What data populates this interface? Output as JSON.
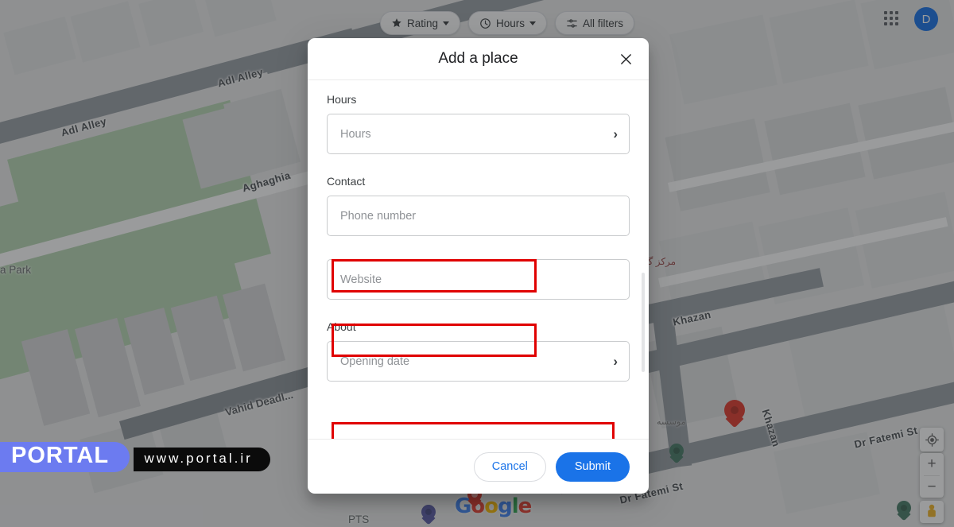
{
  "topbar": {
    "filters": [
      {
        "label": "Rating",
        "icon": "star-icon",
        "has_caret": true
      },
      {
        "label": "Hours",
        "icon": "clock-icon",
        "has_caret": true
      },
      {
        "label": "All filters",
        "icon": "tune-icon",
        "has_caret": false
      }
    ],
    "apps_icon": "apps-grid-icon",
    "avatar_initial": "D"
  },
  "dialog": {
    "title": "Add a place",
    "close_icon": "close-icon",
    "sections": [
      {
        "label": "Hours",
        "fields": [
          {
            "placeholder": "Hours",
            "type": "nav",
            "chevron": "›",
            "highlighted": false
          }
        ]
      },
      {
        "label": "Contact",
        "fields": [
          {
            "placeholder": "Phone number",
            "type": "text",
            "chevron": "",
            "highlighted": true
          },
          {
            "placeholder": "Website",
            "type": "text",
            "chevron": "",
            "highlighted": true
          }
        ]
      },
      {
        "label": "About",
        "fields": [
          {
            "placeholder": "Opening date",
            "type": "nav",
            "chevron": "›",
            "highlighted": true
          }
        ]
      }
    ],
    "footer": {
      "cancel_label": "Cancel",
      "submit_label": "Submit"
    },
    "highlight_color": "#e00000"
  },
  "map": {
    "road_labels": [
      "Adl Alley",
      "Adl Alley",
      "Aghaghia",
      "Khazan",
      "Khazan",
      "Dr Fatemi St",
      "Dr Fatemi St"
    ],
    "place_labels": [
      "a Park",
      "PTS"
    ],
    "persian_labels": [
      "مرکز گا"
    ],
    "attribution": "Google",
    "controls": {
      "locate_icon": "my-location-icon",
      "zoom_in": "+",
      "zoom_out": "−",
      "pegman_icon": "street-view-pegman-icon"
    }
  },
  "watermark": {
    "brand": "PORTAL",
    "url": "www.portal.ir",
    "brand_color": "#6c7bf0"
  }
}
